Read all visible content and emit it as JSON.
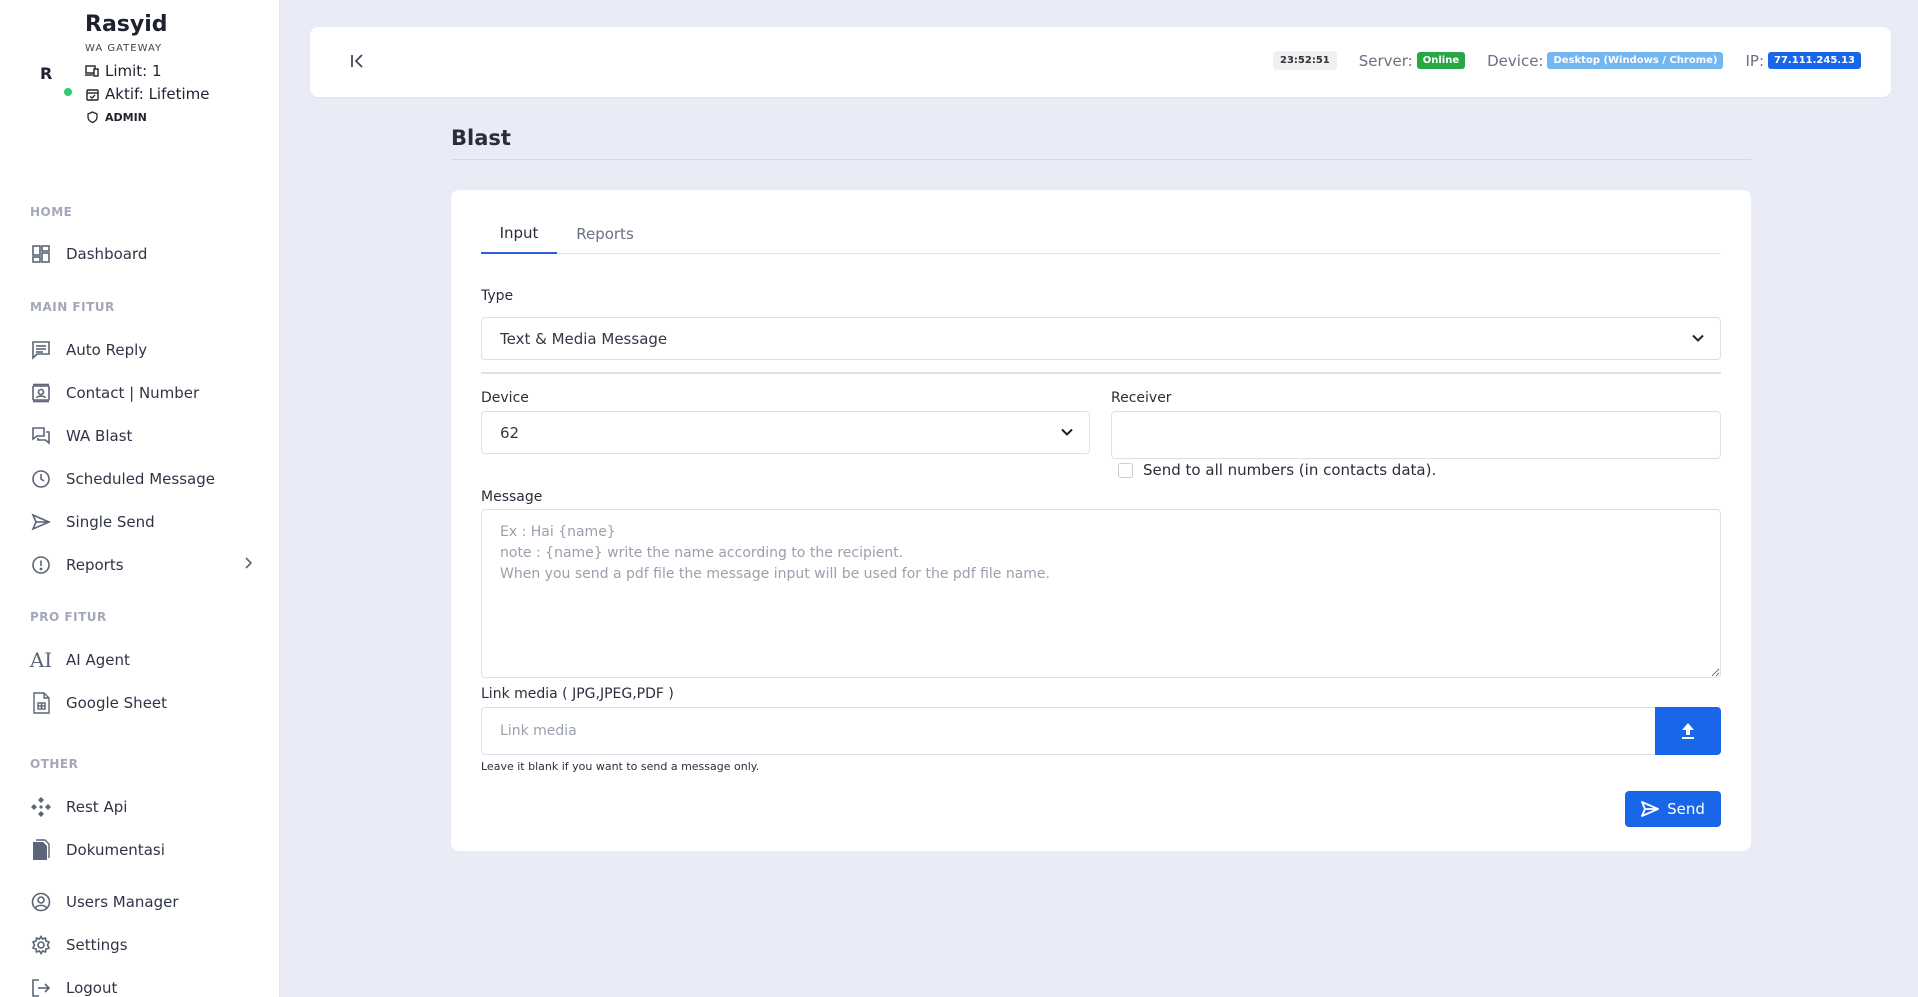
{
  "profile": {
    "initial": "R",
    "name": "Rasyid",
    "subtitle": "WA GATEWAY",
    "limit": "Limit: 1",
    "active": "Aktif: Lifetime",
    "role": "ADMIN"
  },
  "sidebar": {
    "sections": {
      "home": "HOME",
      "main": "MAIN FITUR",
      "pro": "PRO FITUR",
      "other": "OTHER"
    },
    "items": {
      "dashboard": "Dashboard",
      "auto_reply": "Auto Reply",
      "contact": "Contact | Number",
      "wa_blast": "WA Blast",
      "scheduled": "Scheduled Message",
      "single_send": "Single Send",
      "reports": "Reports",
      "ai_agent": "AI Agent",
      "google_sheet": "Google Sheet",
      "rest_api": "Rest Api",
      "dokumentasi": "Dokumentasi",
      "users_manager": "Users Manager",
      "settings": "Settings",
      "logout": "Logout"
    }
  },
  "topbar": {
    "time": "23:52:51",
    "server_label": "Server:",
    "server_status": "Online",
    "device_label": "Device:",
    "device_value": "Desktop (Windows / Chrome)",
    "ip_label": "IP:",
    "ip_value": "77.111.245.13"
  },
  "page": {
    "title": "Blast"
  },
  "form": {
    "tabs": {
      "input": "Input",
      "reports": "Reports"
    },
    "type_label": "Type",
    "type_value": "Text & Media Message",
    "device_label": "Device",
    "device_value": "62",
    "receiver_label": "Receiver",
    "receiver_value": "",
    "send_all_label": "Send to all numbers (in contacts data).",
    "message_label": "Message",
    "message_placeholder": "Ex : Hai {name}\nnote : {name} write the name according to the recipient.\nWhen you send a pdf file the message input will be used for the pdf file name.",
    "media_label": "Link media ( JPG,JPEG,PDF )",
    "media_placeholder": "Link media",
    "media_help": "Leave it blank if you want to send a message only.",
    "send_label": "Send"
  },
  "colors": {
    "accent": "#1a66e8",
    "online": "#28a745",
    "device_badge": "#74b6f0",
    "background": "#e9ecf6"
  }
}
